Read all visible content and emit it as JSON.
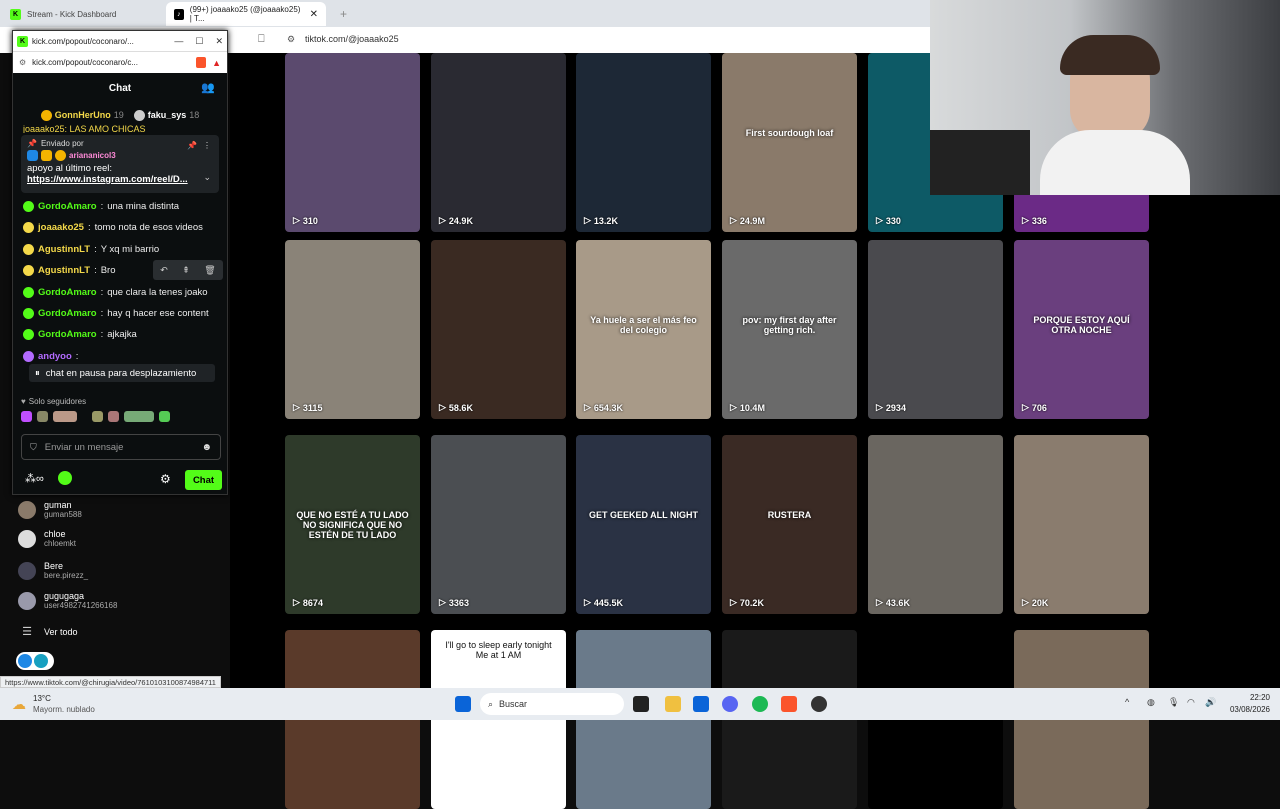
{
  "browser": {
    "tabs": [
      {
        "title": "Stream - Kick Dashboard"
      },
      {
        "title": "(99+) joaaako25 (@joaaako25) | T..."
      }
    ],
    "url": "tiktok.com/@joaaako25",
    "status_url": "https://www.tiktok.com/@chirugia/video/7610103100874984711"
  },
  "popup": {
    "window_title": "kick.com/popout/coconaro/...",
    "url": "kick.com/popout/coconaro/c...",
    "chat_title": "Chat",
    "top_gifters": [
      {
        "name": "GonnHerUno",
        "count": "19"
      },
      {
        "name": "faku_sys",
        "count": "18"
      }
    ],
    "cut_message": "joaaako25: LAS AMO CHICAS",
    "pinned": {
      "sent_by_label": "Enviado por",
      "user": "ariananicol3",
      "text": "apoyo al último reel:",
      "link": "https://www.instagram.com/reel/D..."
    },
    "messages": [
      {
        "user": "GordoAmaro",
        "text": "una mina distinta",
        "color": "#53fc18"
      },
      {
        "user": "joaaako25",
        "text": "tomo nota de esos videos",
        "color": "#f4d94a"
      },
      {
        "user": "AgustinnLT",
        "text": "Y xq mi barrio",
        "color": "#f4d94a"
      },
      {
        "user": "AgustinnLT",
        "text": "Bro",
        "color": "#f4d94a"
      },
      {
        "user": "GordoAmaro",
        "text": "que clara la tenes joako",
        "color": "#53fc18"
      },
      {
        "user": "GordoAmaro",
        "text": "hay q hacer ese content",
        "color": "#53fc18"
      },
      {
        "user": "GordoAmaro",
        "text": "ajkajka",
        "color": "#53fc18"
      },
      {
        "user": "andyoo",
        "text": "",
        "color": "#b36bff"
      }
    ],
    "paused_text": "chat en pausa para desplazamiento",
    "followers_only": "Solo seguidores",
    "input_placeholder": "Enviar un mensaje",
    "chat_button": "Chat"
  },
  "following": [
    {
      "name": "guman",
      "handle": "guman588"
    },
    {
      "name": "chloe",
      "handle": "chloemkt"
    },
    {
      "name": "Bere",
      "handle": "bere.pirezz_"
    },
    {
      "name": "gugugaga",
      "handle": "user4982741266168"
    }
  ],
  "see_all": "Ver todo",
  "videos": [
    {
      "views": "310",
      "color": "#5b4a6e",
      "overlay": ""
    },
    {
      "views": "24.9K",
      "color": "#2a2a32",
      "overlay": ""
    },
    {
      "views": "13.2K",
      "color": "#1d2836",
      "overlay": ""
    },
    {
      "views": "24.9M",
      "color": "#8a7a6a",
      "overlay": "First sourdough loaf"
    },
    {
      "views": "330",
      "color": "#0d5a66",
      "overlay": ""
    },
    {
      "views": "336",
      "color": "#6b2a86",
      "overlay": ""
    },
    {
      "views": "3115",
      "color": "#8a8378",
      "overlay": ""
    },
    {
      "views": "58.6K",
      "color": "#3a2a22",
      "overlay": ""
    },
    {
      "views": "654.3K",
      "color": "#a89a88",
      "overlay": "Ya huele a ser el más feo del colegio"
    },
    {
      "views": "10.4M",
      "color": "#6a6a6a",
      "overlay": "pov: my first day after getting rich."
    },
    {
      "views": "2934",
      "color": "#4a4a4e",
      "overlay": ""
    },
    {
      "views": "706",
      "color": "#6a3f7e",
      "overlay": "PORQUE ESTOY AQUÍ OTRA NOCHE"
    },
    {
      "views": "8674",
      "color": "#2e3a2a",
      "overlay": "QUE NO ESTÉ A TU LADO NO SIGNIFICA QUE NO ESTÉN DE TU LADO"
    },
    {
      "views": "3363",
      "color": "#4b4e52",
      "overlay": ""
    },
    {
      "views": "445.5K",
      "color": "#2a3244",
      "overlay": "GET GEEKED ALL NIGHT"
    },
    {
      "views": "70.2K",
      "color": "#3a2a24",
      "overlay": "RUSTERA"
    },
    {
      "views": "43.6K",
      "color": "#6a6660",
      "overlay": ""
    },
    {
      "views": "20K",
      "color": "#8a7c6e",
      "overlay": ""
    },
    {
      "views": "",
      "color": "#5a3a2a",
      "overlay": ""
    },
    {
      "views": "",
      "color": "#ffffff",
      "overlay": "I'll go to sleep early tonight\nMe at 1 AM"
    },
    {
      "views": "",
      "color": "#6a7a8a",
      "overlay": ""
    },
    {
      "views": "",
      "color": "#1a1a1a",
      "overlay": ""
    },
    {
      "views": "",
      "color": "#000000",
      "overlay": ""
    },
    {
      "views": "",
      "color": "#7a6a5a",
      "overlay": ""
    }
  ],
  "taskbar": {
    "weather_temp": "13°C",
    "weather_desc": "Mayorm. nublado",
    "search_placeholder": "Buscar",
    "time": "22:20",
    "date": "03/08/2026"
  }
}
